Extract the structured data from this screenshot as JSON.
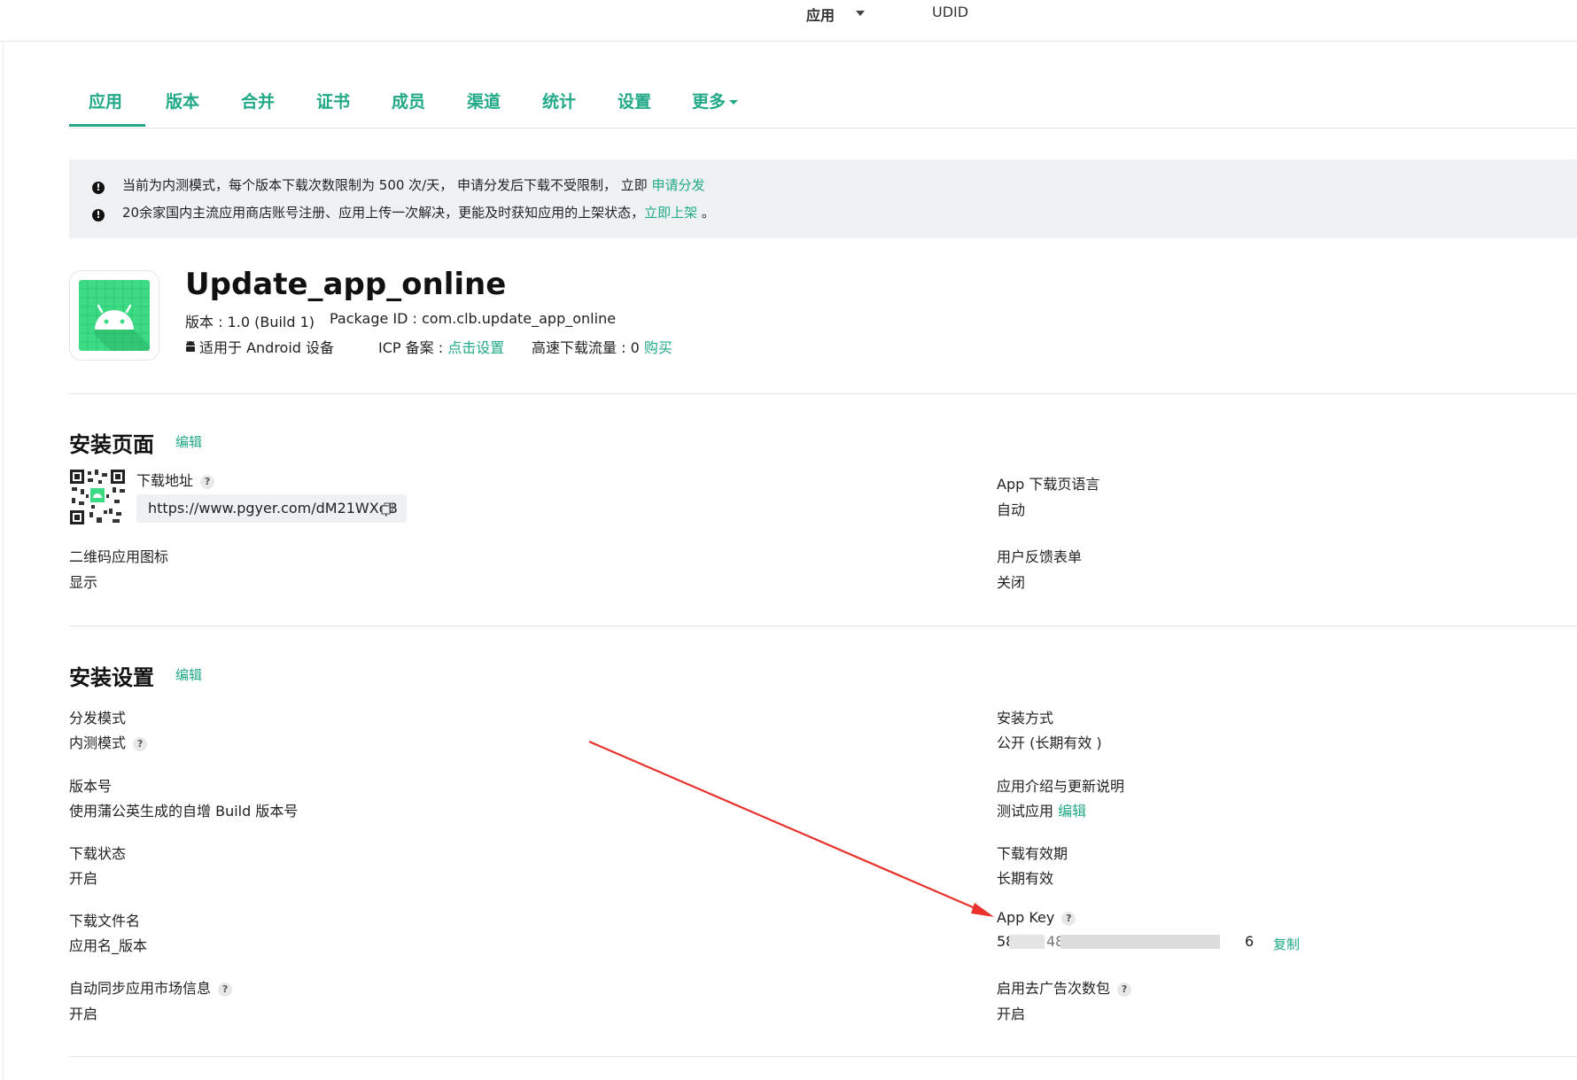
{
  "topbar": {
    "apps_menu": "应用",
    "udid": "UDID"
  },
  "nav": {
    "tabs": [
      {
        "label": "应用"
      },
      {
        "label": "版本"
      },
      {
        "label": "合并"
      },
      {
        "label": "证书"
      },
      {
        "label": "成员"
      },
      {
        "label": "渠道"
      },
      {
        "label": "统计"
      },
      {
        "label": "设置"
      },
      {
        "label": "更多"
      }
    ],
    "active": "应用"
  },
  "notice": {
    "line1_text": "当前为内测模式，每个版本下载次数限制为 500 次/天， 申请分发后下载不受限制， 立即",
    "line1_link": "申请分发",
    "line2_text": "20余家国内主流应用商店账号注册、应用上传一次解决，更能及时获知应用的上架状态，",
    "line2_link": "立即上架",
    "line2_tail": "。"
  },
  "app": {
    "name": "Update_app_online",
    "version_label": "版本 : 1.0 (Build 1)",
    "package_label": "Package ID : com.clb.update_app_online",
    "platform": "适用于 Android 设备",
    "icp_label": "ICP 备案 :",
    "icp_link": "点击设置",
    "traffic_label": "高速下载流量 : 0",
    "traffic_link": "购买"
  },
  "install_page": {
    "title": "安装页面",
    "edit": "编辑",
    "download_url_label": "下载地址",
    "download_url": "https://www.pgyer.com/dM21WXqB",
    "lang_label": "App 下载页语言",
    "lang_value": "自动",
    "qr_icon_label": "二维码应用图标",
    "qr_icon_value": "显示",
    "feedback_label": "用户反馈表单",
    "feedback_value": "关闭"
  },
  "install_settings": {
    "title": "安装设置",
    "edit": "编辑",
    "dist_mode_label": "分发模式",
    "dist_mode_value": "内测模式",
    "install_method_label": "安装方式",
    "install_method_value": "公开 (长期有效 )",
    "version_no_label": "版本号",
    "version_no_value": "使用蒲公英生成的自增 Build 版本号",
    "intro_label": "应用介绍与更新说明",
    "intro_value": "测试应用",
    "intro_edit": "编辑",
    "dl_status_label": "下载状态",
    "dl_status_value": "开启",
    "dl_expiry_label": "下载有效期",
    "dl_expiry_value": "长期有效",
    "filename_label": "下载文件名",
    "filename_value": "应用名_版本",
    "appkey_label": "App Key",
    "appkey_start": "58",
    "appkey_mid": "48",
    "appkey_end": "6",
    "appkey_copy": "复制",
    "sync_label": "自动同步应用市场信息",
    "sync_value": "开启",
    "adfree_label": "启用去广告次数包",
    "adfree_value": "开启"
  },
  "colors": {
    "accent": "#21a988",
    "notice_bg": "#eef1f3",
    "arrow": "#e8322b",
    "android": "#3ddc84"
  },
  "icons": [
    "caret-down-icon",
    "exclamation-icon",
    "android-icon",
    "qr-code-icon",
    "copy-icon",
    "help-icon",
    "arrow-annotation"
  ]
}
